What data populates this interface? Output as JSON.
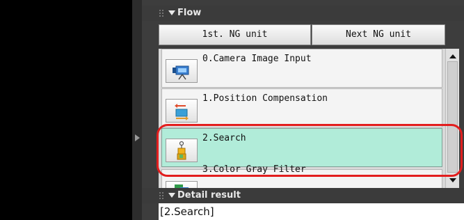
{
  "flow": {
    "header": "Flow",
    "first_ng_label": "1st. NG unit",
    "next_ng_label": "Next NG unit",
    "items": [
      {
        "label": "0.Camera Image Input",
        "icon": "camera-input-icon"
      },
      {
        "label": "1.Position Compensation",
        "icon": "position-compensation-icon"
      },
      {
        "label": "2.Search",
        "icon": "search-model-icon",
        "selected": true
      },
      {
        "label": "3.Color Gray Filter",
        "icon": "color-gray-filter-icon"
      }
    ]
  },
  "detail": {
    "header": "Detail result",
    "text": "[2.Search]"
  },
  "colors": {
    "selected_bg": "#b1ecd9",
    "highlight": "#e21e1e"
  }
}
